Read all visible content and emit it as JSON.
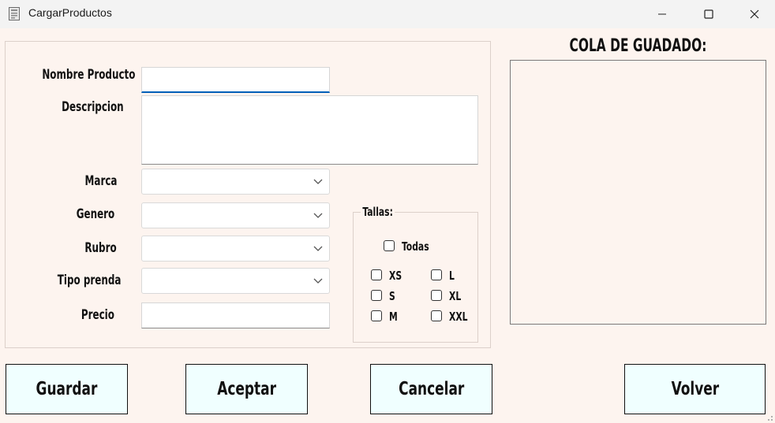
{
  "window": {
    "title": "CargarProductos"
  },
  "form": {
    "nombre_label": "Nombre Producto",
    "nombre_value": "",
    "descripcion_label": "Descripcion",
    "descripcion_value": "",
    "marca_label": "Marca",
    "marca_value": "",
    "genero_label": "Genero",
    "genero_value": "",
    "rubro_label": "Rubro",
    "rubro_value": "",
    "tipo_label": "Tipo prenda",
    "tipo_value": "",
    "precio_label": "Precio",
    "precio_value": ""
  },
  "tallas": {
    "title": "Tallas:",
    "todas": "Todas",
    "sizes": [
      "XS",
      "S",
      "M",
      "L",
      "XL",
      "XXL"
    ]
  },
  "queue": {
    "title": "COLA DE GUADADO:"
  },
  "buttons": {
    "guardar": "Guardar",
    "aceptar": "Aceptar",
    "cancelar": "Cancelar",
    "volver": "Volver"
  },
  "icons": {
    "app": "document-icon",
    "minimize": "minimize-icon",
    "maximize": "maximize-icon",
    "close": "close-icon",
    "dropdown": "chevron-down-icon"
  }
}
